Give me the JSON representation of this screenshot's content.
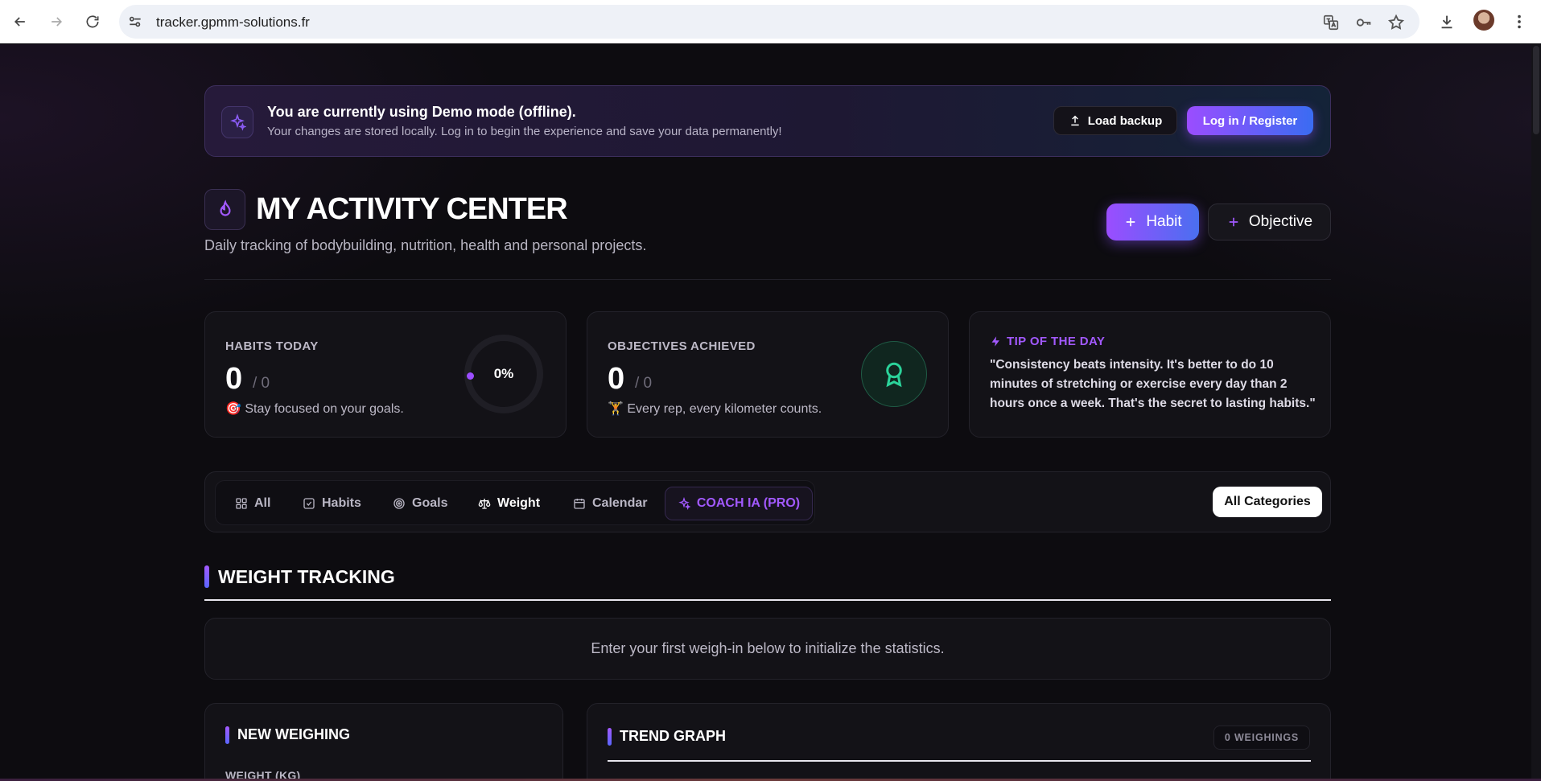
{
  "browser": {
    "url": "tracker.gpmm-solutions.fr"
  },
  "banner": {
    "title": "You are currently using Demo mode (offline).",
    "subtitle": "Your changes are stored locally. Log in to begin the experience and save your data permanently!",
    "load_backup_label": "Load backup",
    "login_label": "Log in / Register"
  },
  "header": {
    "title": "MY ACTIVITY CENTER",
    "subtitle": "Daily tracking of bodybuilding, nutrition, health and personal projects.",
    "habit_button": "Habit",
    "objective_button": "Objective"
  },
  "stats": {
    "habits": {
      "label": "HABITS TODAY",
      "value": "0",
      "total": "/ 0",
      "note": "🎯 Stay focused on your goals.",
      "percent": "0%"
    },
    "objectives": {
      "label": "OBJECTIVES ACHIEVED",
      "value": "0",
      "total": "/ 0",
      "note": "🏋 Every rep, every kilometer counts."
    },
    "tip": {
      "label": "TIP OF THE DAY",
      "text": "\"Consistency beats intensity. It's better to do 10 minutes of stretching or exercise every day than 2 hours once a week. That's the secret to lasting habits.\""
    }
  },
  "tabs": {
    "all": "All",
    "habits": "Habits",
    "goals": "Goals",
    "weight": "Weight",
    "calendar": "Calendar",
    "coach": "COACH IA (PRO)",
    "active": "Weight"
  },
  "category_filter": "All Categories",
  "weight_section": {
    "title": "WEIGHT TRACKING",
    "empty_message": "Enter your first weigh-in below to initialize the statistics.",
    "new_weighing": {
      "title": "NEW WEIGHING",
      "field_label": "WEIGHT (KG)"
    },
    "trend": {
      "title": "TREND GRAPH",
      "badge": "0 WEIGHINGS"
    }
  },
  "colors": {
    "accent": "#a259ff",
    "accent_blue": "#3a6cf2",
    "success": "#2bd39a",
    "background": "#0d0c10"
  }
}
